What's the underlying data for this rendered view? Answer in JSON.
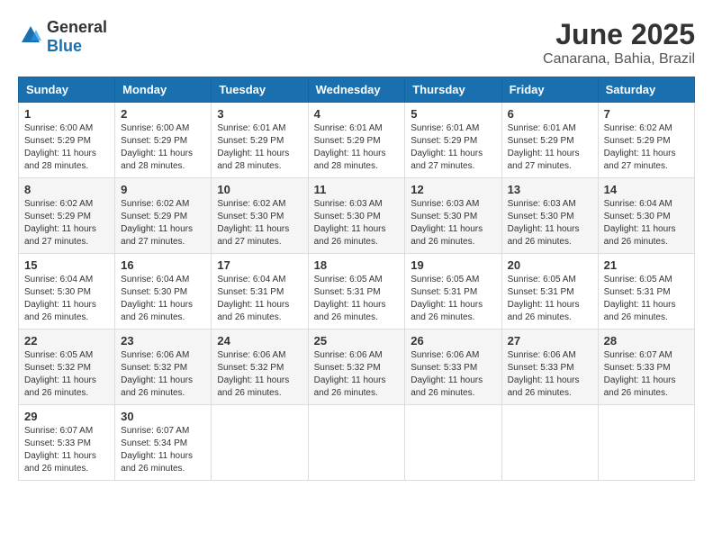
{
  "header": {
    "logo_general": "General",
    "logo_blue": "Blue",
    "month": "June 2025",
    "location": "Canarana, Bahia, Brazil"
  },
  "weekdays": [
    "Sunday",
    "Monday",
    "Tuesday",
    "Wednesday",
    "Thursday",
    "Friday",
    "Saturday"
  ],
  "weeks": [
    [
      {
        "day": "1",
        "sunrise": "6:00 AM",
        "sunset": "5:29 PM",
        "daylight": "11 hours and 28 minutes."
      },
      {
        "day": "2",
        "sunrise": "6:00 AM",
        "sunset": "5:29 PM",
        "daylight": "11 hours and 28 minutes."
      },
      {
        "day": "3",
        "sunrise": "6:01 AM",
        "sunset": "5:29 PM",
        "daylight": "11 hours and 28 minutes."
      },
      {
        "day": "4",
        "sunrise": "6:01 AM",
        "sunset": "5:29 PM",
        "daylight": "11 hours and 28 minutes."
      },
      {
        "day": "5",
        "sunrise": "6:01 AM",
        "sunset": "5:29 PM",
        "daylight": "11 hours and 27 minutes."
      },
      {
        "day": "6",
        "sunrise": "6:01 AM",
        "sunset": "5:29 PM",
        "daylight": "11 hours and 27 minutes."
      },
      {
        "day": "7",
        "sunrise": "6:02 AM",
        "sunset": "5:29 PM",
        "daylight": "11 hours and 27 minutes."
      }
    ],
    [
      {
        "day": "8",
        "sunrise": "6:02 AM",
        "sunset": "5:29 PM",
        "daylight": "11 hours and 27 minutes."
      },
      {
        "day": "9",
        "sunrise": "6:02 AM",
        "sunset": "5:29 PM",
        "daylight": "11 hours and 27 minutes."
      },
      {
        "day": "10",
        "sunrise": "6:02 AM",
        "sunset": "5:30 PM",
        "daylight": "11 hours and 27 minutes."
      },
      {
        "day": "11",
        "sunrise": "6:03 AM",
        "sunset": "5:30 PM",
        "daylight": "11 hours and 26 minutes."
      },
      {
        "day": "12",
        "sunrise": "6:03 AM",
        "sunset": "5:30 PM",
        "daylight": "11 hours and 26 minutes."
      },
      {
        "day": "13",
        "sunrise": "6:03 AM",
        "sunset": "5:30 PM",
        "daylight": "11 hours and 26 minutes."
      },
      {
        "day": "14",
        "sunrise": "6:04 AM",
        "sunset": "5:30 PM",
        "daylight": "11 hours and 26 minutes."
      }
    ],
    [
      {
        "day": "15",
        "sunrise": "6:04 AM",
        "sunset": "5:30 PM",
        "daylight": "11 hours and 26 minutes."
      },
      {
        "day": "16",
        "sunrise": "6:04 AM",
        "sunset": "5:30 PM",
        "daylight": "11 hours and 26 minutes."
      },
      {
        "day": "17",
        "sunrise": "6:04 AM",
        "sunset": "5:31 PM",
        "daylight": "11 hours and 26 minutes."
      },
      {
        "day": "18",
        "sunrise": "6:05 AM",
        "sunset": "5:31 PM",
        "daylight": "11 hours and 26 minutes."
      },
      {
        "day": "19",
        "sunrise": "6:05 AM",
        "sunset": "5:31 PM",
        "daylight": "11 hours and 26 minutes."
      },
      {
        "day": "20",
        "sunrise": "6:05 AM",
        "sunset": "5:31 PM",
        "daylight": "11 hours and 26 minutes."
      },
      {
        "day": "21",
        "sunrise": "6:05 AM",
        "sunset": "5:31 PM",
        "daylight": "11 hours and 26 minutes."
      }
    ],
    [
      {
        "day": "22",
        "sunrise": "6:05 AM",
        "sunset": "5:32 PM",
        "daylight": "11 hours and 26 minutes."
      },
      {
        "day": "23",
        "sunrise": "6:06 AM",
        "sunset": "5:32 PM",
        "daylight": "11 hours and 26 minutes."
      },
      {
        "day": "24",
        "sunrise": "6:06 AM",
        "sunset": "5:32 PM",
        "daylight": "11 hours and 26 minutes."
      },
      {
        "day": "25",
        "sunrise": "6:06 AM",
        "sunset": "5:32 PM",
        "daylight": "11 hours and 26 minutes."
      },
      {
        "day": "26",
        "sunrise": "6:06 AM",
        "sunset": "5:33 PM",
        "daylight": "11 hours and 26 minutes."
      },
      {
        "day": "27",
        "sunrise": "6:06 AM",
        "sunset": "5:33 PM",
        "daylight": "11 hours and 26 minutes."
      },
      {
        "day": "28",
        "sunrise": "6:07 AM",
        "sunset": "5:33 PM",
        "daylight": "11 hours and 26 minutes."
      }
    ],
    [
      {
        "day": "29",
        "sunrise": "6:07 AM",
        "sunset": "5:33 PM",
        "daylight": "11 hours and 26 minutes."
      },
      {
        "day": "30",
        "sunrise": "6:07 AM",
        "sunset": "5:34 PM",
        "daylight": "11 hours and 26 minutes."
      },
      null,
      null,
      null,
      null,
      null
    ]
  ]
}
